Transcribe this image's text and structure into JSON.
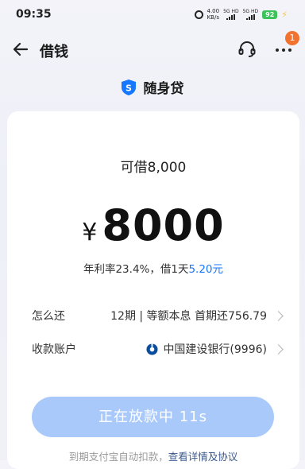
{
  "status_bar": {
    "time": "09:35",
    "net_speed_value": "4.00",
    "net_speed_unit": "KB/s",
    "sim1_label": "5G HD",
    "sim2_label": "5G HD",
    "battery": "92"
  },
  "nav": {
    "title": "借钱",
    "badge_count": "1"
  },
  "brand": {
    "name": "随身贷",
    "accent_color": "#1677ff"
  },
  "loan": {
    "limit_text": "可借8,000",
    "currency": "¥",
    "amount": "8000",
    "rate_text": "年利率23.4%，借1天",
    "daily_cost": "5.20元"
  },
  "repay": {
    "label": "怎么还",
    "value": "12期 | 等额本息 首期还756.79"
  },
  "account": {
    "label": "收款账户",
    "value": "中国建设银行(9996)"
  },
  "submit": {
    "label": "正在放款中 11s"
  },
  "agreement": {
    "prefix": "到期支付宝自动扣款，",
    "link": "查看详情及协议"
  },
  "icons": [
    "back-arrow-icon",
    "headset-icon",
    "more-icon",
    "shield-s-icon",
    "ccb-bank-icon",
    "chevron-right-icon",
    "alarm-icon",
    "signal-icon",
    "charging-icon"
  ]
}
